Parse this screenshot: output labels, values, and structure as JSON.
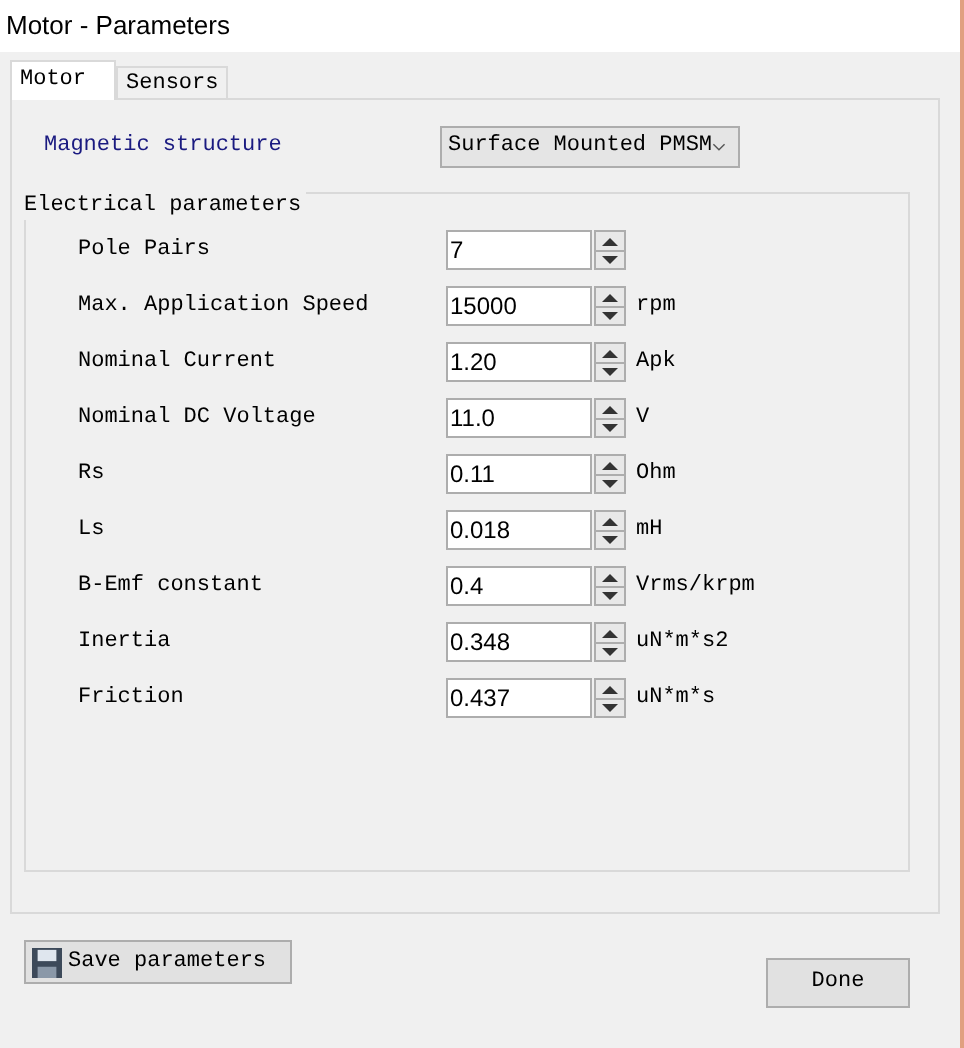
{
  "window": {
    "title": "Motor - Parameters"
  },
  "tabs": [
    {
      "label": "Motor",
      "selected": true
    },
    {
      "label": "Sensors",
      "selected": false
    }
  ],
  "magnetic_structure": {
    "label": "Magnetic structure",
    "value": "Surface Mounted PMSM"
  },
  "electrical_parameters": {
    "title": "Electrical parameters",
    "rows": [
      {
        "label": "Pole Pairs",
        "value": "7"
      },
      {
        "label": "Max. Application Speed",
        "value": "15000",
        "unit": "rpm"
      },
      {
        "label": "Nominal Current",
        "value": "1.20",
        "unit": "Apk"
      },
      {
        "label": "Nominal DC Voltage",
        "value": "11.0",
        "unit": "V"
      },
      {
        "label": "Rs",
        "value": "0.11",
        "unit": "Ohm"
      },
      {
        "label": "Ls",
        "value": "0.018",
        "unit": "mH"
      },
      {
        "label": "B-Emf constant",
        "value": "0.4",
        "unit": "Vrms/krpm"
      },
      {
        "label": "Inertia",
        "value": "0.348",
        "unit": "uN*m*s2"
      },
      {
        "label": "Friction",
        "value": "0.437",
        "unit": "uN*m*s"
      }
    ]
  },
  "buttons": {
    "save": "Save parameters",
    "done": "Done"
  }
}
